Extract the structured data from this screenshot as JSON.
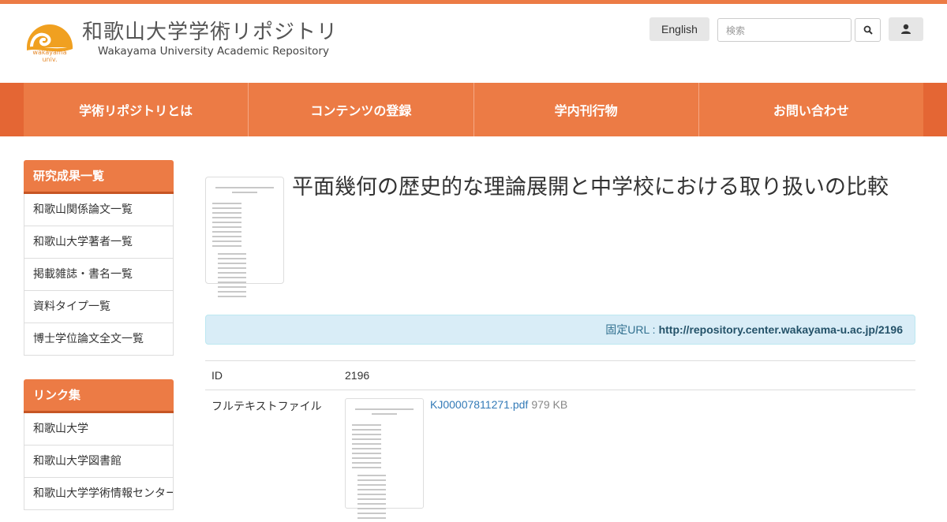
{
  "header": {
    "site_title_ja": "和歌山大学学術リポジトリ",
    "site_title_en": "Wakayama University Academic Repository",
    "logo_sub": "wakayama",
    "logo_sub2": "univ.",
    "lang_button": "English",
    "search_placeholder": "検索",
    "accent_color": "#ec7b45"
  },
  "nav": {
    "items": [
      "学術リポジトリとは",
      "コンテンツの登録",
      "学内刊行物",
      "お問い合わせ"
    ]
  },
  "sidebar": {
    "group1": {
      "title": "研究成果一覧",
      "items": [
        "和歌山関係論文一覧",
        "和歌山大学著者一覧",
        "掲載雑誌・書名一覧",
        "資料タイプ一覧",
        "博士学位論文全文一覧"
      ]
    },
    "group2": {
      "title": "リンク集",
      "items": [
        "和歌山大学",
        "和歌山大学図書館",
        "和歌山大学学術情報センター"
      ]
    }
  },
  "main": {
    "title": "平面幾何の歴史的な理論展開と中学校における取り扱いの比較",
    "url_label": "固定URL :",
    "url_value": "http://repository.center.wakayama-u.ac.jp/2196",
    "meta": {
      "id_label": "ID",
      "id_value": "2196",
      "file_label": "フルテキストファイル",
      "file_name": "KJ00007811271.pdf",
      "file_size": "979 KB"
    }
  }
}
